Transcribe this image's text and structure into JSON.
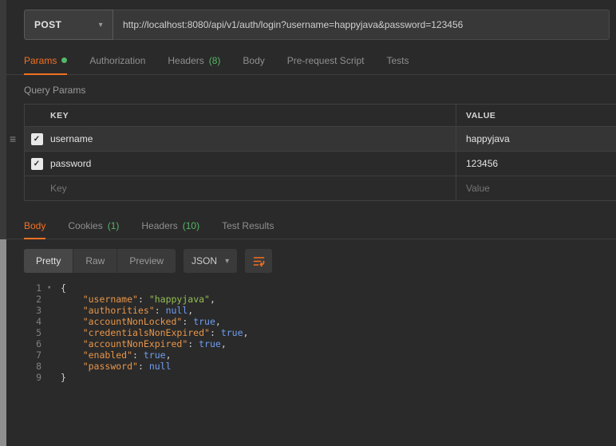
{
  "icons": {
    "chevron_down": "▾",
    "drag_handle": "≡",
    "check": "✓",
    "fold": "▾"
  },
  "request": {
    "method": "POST",
    "url": "http://localhost:8080/api/v1/auth/login?username=happyjava&password=123456",
    "tabs": [
      {
        "label": "Params"
      },
      {
        "label": "Authorization"
      },
      {
        "label": "Headers",
        "count": "(8)"
      },
      {
        "label": "Body"
      },
      {
        "label": "Pre-request Script"
      },
      {
        "label": "Tests"
      }
    ]
  },
  "params": {
    "section_title": "Query Params",
    "col_key": "KEY",
    "col_value": "VALUE",
    "rows": [
      {
        "key": "username",
        "value": "happyjava",
        "checked": true
      },
      {
        "key": "password",
        "value": "123456",
        "checked": true
      }
    ],
    "placeholder_key": "Key",
    "placeholder_value": "Value"
  },
  "response": {
    "tabs": [
      {
        "label": "Body"
      },
      {
        "label": "Cookies",
        "count": "(1)"
      },
      {
        "label": "Headers",
        "count": "(10)"
      },
      {
        "label": "Test Results"
      }
    ],
    "modes": [
      "Pretty",
      "Raw",
      "Preview"
    ],
    "format": "JSON",
    "code": {
      "lines": [
        {
          "n": "1",
          "fold": true,
          "tokens": [
            [
              "p",
              "{"
            ]
          ]
        },
        {
          "n": "2",
          "tokens": [
            [
              "w",
              "    "
            ],
            [
              "k",
              "\"username\""
            ],
            [
              "p",
              ": "
            ],
            [
              "s",
              "\"happyjava\""
            ],
            [
              "p",
              ","
            ]
          ]
        },
        {
          "n": "3",
          "tokens": [
            [
              "w",
              "    "
            ],
            [
              "k",
              "\"authorities\""
            ],
            [
              "p",
              ": "
            ],
            [
              "l",
              "null"
            ],
            [
              "p",
              ","
            ]
          ]
        },
        {
          "n": "4",
          "tokens": [
            [
              "w",
              "    "
            ],
            [
              "k",
              "\"accountNonLocked\""
            ],
            [
              "p",
              ": "
            ],
            [
              "l",
              "true"
            ],
            [
              "p",
              ","
            ]
          ]
        },
        {
          "n": "5",
          "tokens": [
            [
              "w",
              "    "
            ],
            [
              "k",
              "\"credentialsNonExpired\""
            ],
            [
              "p",
              ": "
            ],
            [
              "l",
              "true"
            ],
            [
              "p",
              ","
            ]
          ]
        },
        {
          "n": "6",
          "tokens": [
            [
              "w",
              "    "
            ],
            [
              "k",
              "\"accountNonExpired\""
            ],
            [
              "p",
              ": "
            ],
            [
              "l",
              "true"
            ],
            [
              "p",
              ","
            ]
          ]
        },
        {
          "n": "7",
          "tokens": [
            [
              "w",
              "    "
            ],
            [
              "k",
              "\"enabled\""
            ],
            [
              "p",
              ": "
            ],
            [
              "l",
              "true"
            ],
            [
              "p",
              ","
            ]
          ]
        },
        {
          "n": "8",
          "tokens": [
            [
              "w",
              "    "
            ],
            [
              "k",
              "\"password\""
            ],
            [
              "p",
              ": "
            ],
            [
              "l",
              "null"
            ]
          ]
        },
        {
          "n": "9",
          "tokens": [
            [
              "p",
              "}"
            ]
          ]
        }
      ]
    }
  },
  "colors": {
    "accent_orange": "#f47023",
    "count_green": "#55b767",
    "json_key": "#e8964a",
    "json_string": "#94bf54",
    "json_literal": "#6f9df1"
  }
}
